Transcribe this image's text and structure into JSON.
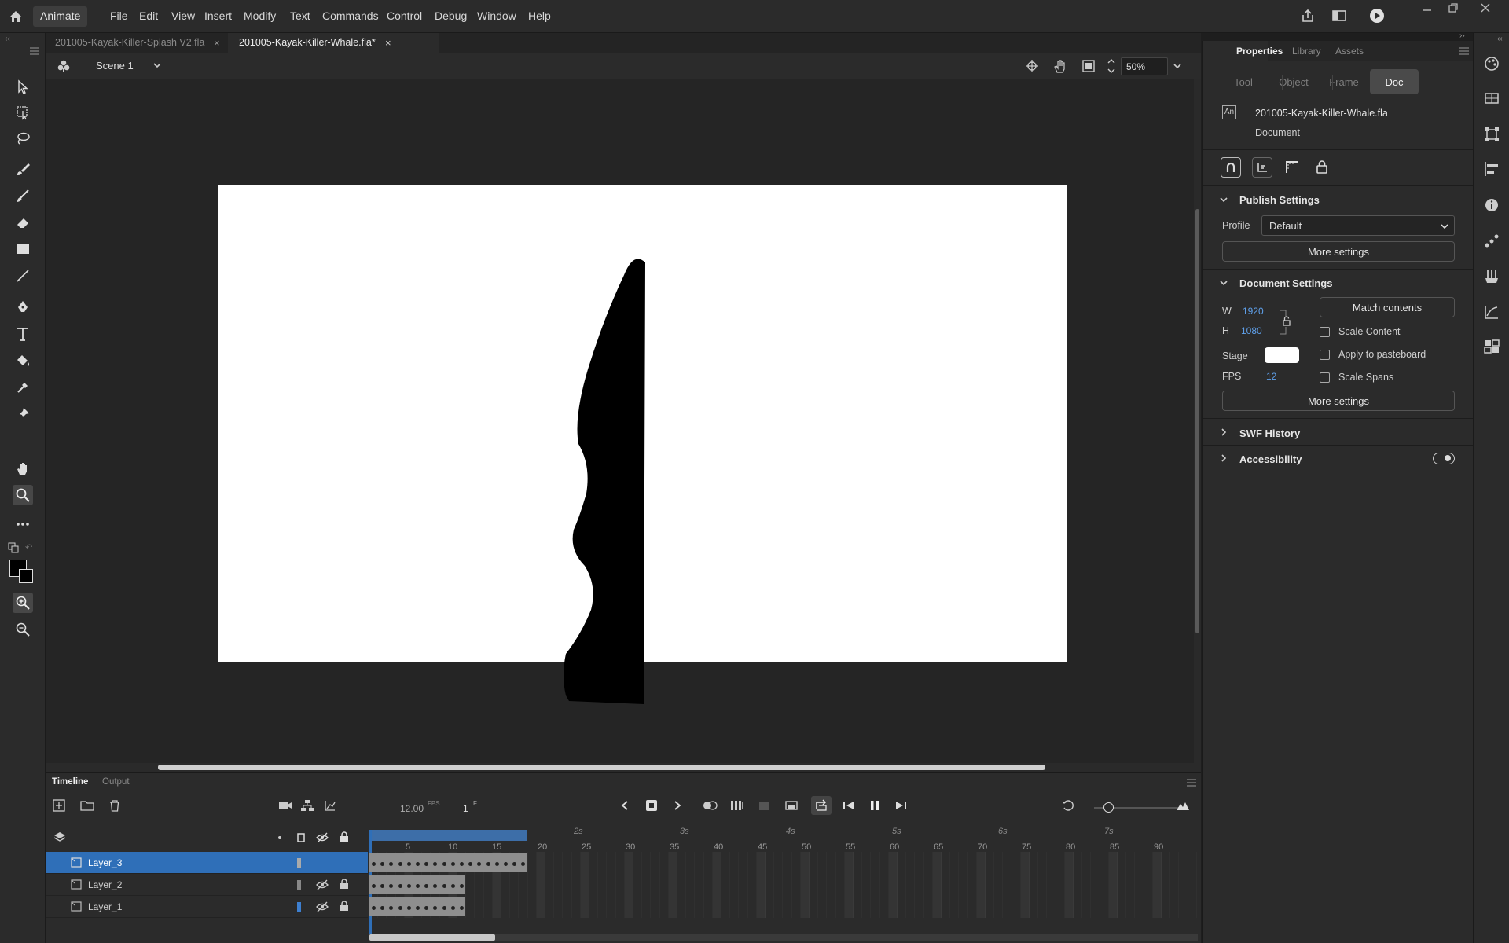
{
  "app": {
    "name": "Animate"
  },
  "menu": [
    "File",
    "Edit",
    "View",
    "Insert",
    "Modify",
    "Text",
    "Commands",
    "Control",
    "Debug",
    "Window",
    "Help"
  ],
  "tabs": [
    {
      "label": "201005-Kayak-Killer-Splash V2.fla",
      "active": false
    },
    {
      "label": "201005-Kayak-Killer-Whale.fla*",
      "active": true
    }
  ],
  "scene": {
    "label": "Scene 1",
    "zoom": "50%"
  },
  "properties": {
    "panel_tabs": [
      "Properties",
      "Library",
      "Assets"
    ],
    "mode_tabs": [
      "Tool",
      "Object",
      "Frame",
      "Doc"
    ],
    "active_mode": "Doc",
    "doc_badge": "An",
    "file_name": "201005-Kayak-Killer-Whale.fla",
    "file_type": "Document",
    "publish": {
      "title": "Publish Settings",
      "profile_label": "Profile",
      "profile_value": "Default",
      "more": "More settings"
    },
    "document": {
      "title": "Document Settings",
      "w_label": "W",
      "w_value": "1920",
      "h_label": "H",
      "h_value": "1080",
      "match": "Match contents",
      "scale_content": "Scale Content",
      "apply_pasteboard": "Apply to pasteboard",
      "scale_spans": "Scale Spans",
      "stage_label": "Stage",
      "fps_label": "FPS",
      "fps_value": "12",
      "more": "More settings"
    },
    "swf_history": "SWF History",
    "accessibility": "Accessibility",
    "accessibility_on": true
  },
  "timeline": {
    "tab_timeline": "Timeline",
    "tab_output": "Output",
    "fps": "12.00",
    "fps_unit": "FPS",
    "frame": "1",
    "frame_unit": "F",
    "seconds": [
      "2s",
      "3s",
      "4s",
      "5s",
      "6s",
      "7s"
    ],
    "frame_numbers": [
      "5",
      "10",
      "15",
      "20",
      "25",
      "30",
      "35",
      "40",
      "45",
      "50",
      "55",
      "60",
      "65",
      "70",
      "75",
      "80",
      "85",
      "90"
    ],
    "layers": [
      {
        "name": "Layer_3",
        "selected": true,
        "frames": 18
      },
      {
        "name": "Layer_2",
        "selected": false,
        "frames": 11
      },
      {
        "name": "Layer_1",
        "selected": false,
        "frames": 11
      }
    ]
  },
  "colors": {
    "accent": "#2f6fb8",
    "stage": "#ffffff",
    "pasteboard": "#252525",
    "panel": "#2b2b2b",
    "blue_value": "#5fa0ea"
  }
}
